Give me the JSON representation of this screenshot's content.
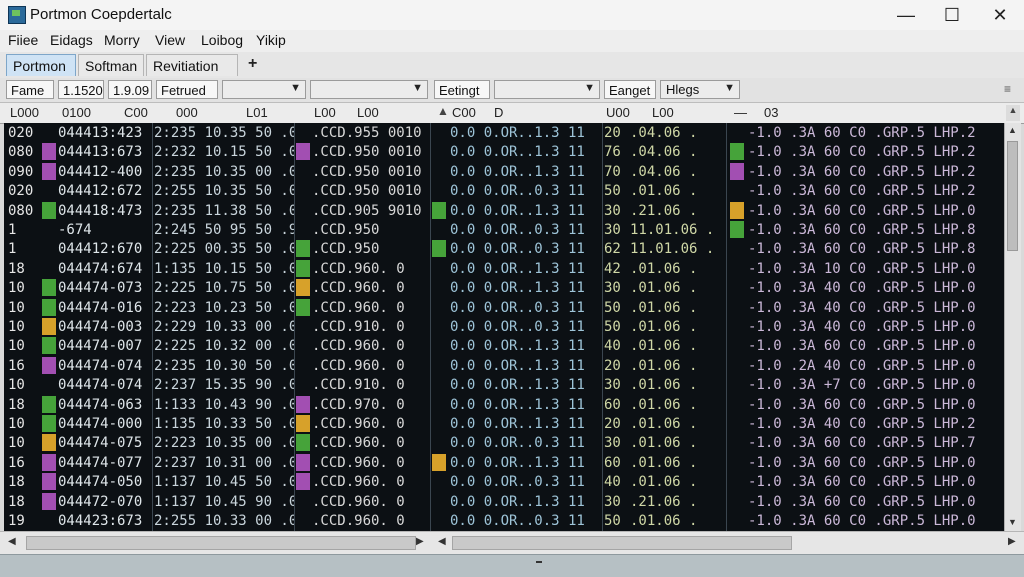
{
  "window": {
    "title": "Portmon Coepdertalc",
    "minimize": "—",
    "maximize": "☐",
    "close": "✕"
  },
  "menu": [
    "Fiiee",
    "Eidags",
    "Morry",
    "View",
    "Loibog",
    "Yikip"
  ],
  "tabs": [
    {
      "label": "Portmon",
      "active": true
    },
    {
      "label": "Softman",
      "active": false
    },
    {
      "label": "Revitiation",
      "active": false
    }
  ],
  "tab_add": "+",
  "toolbar": {
    "frame_label": "Fame",
    "field1": "1.1520",
    "field2": "1.9.09",
    "filter_label": "Fetrued",
    "settings_label": "Eetingt",
    "range_label": "Eanget",
    "flags_label": "Hlegs",
    "right_icon": "≡"
  },
  "columns": [
    "L000",
    "0100",
    "C00",
    "000",
    "L01",
    "L00",
    "L00",
    "C00",
    "D",
    "U00",
    "L00",
    "—",
    "03"
  ],
  "rows": [
    [
      "020",
      "A",
      "044413:423",
      "2:235 10.35 50 .0",
      "",
      ".CCD.955 0010",
      "",
      "0.0 0.OR..1.3 11",
      "20",
      ".04.06 .",
      "",
      "-1.0 .3A 60 C0 .GRP.5 LHP.2"
    ],
    [
      "080",
      "V",
      "044413:673",
      "2:232 10.15 50 .0",
      "V",
      ".CCD.950 0010",
      "",
      "0.0 0.OR..1.3 11",
      "76",
      ".04.06 .",
      "G",
      "-1.0 .3A 60 C0 .GRP.5 LHP.2"
    ],
    [
      "090",
      "V",
      "044412-400",
      "2:235 10.35 00 .0",
      "",
      ".CCD.950 0010",
      "",
      "0.0 0.OR..1.3 11",
      "70",
      ".04.06 .",
      "V",
      "-1.0 .3A 60 C0 .GRP.5 LHP.2"
    ],
    [
      "020",
      "",
      "044412:672",
      "2:255 10.35 50 .0",
      "",
      ".CCD.950 0010",
      "",
      "0.0 0.OR..0.3 11",
      "50",
      ".01.06 .",
      "",
      "-1.0 .3A 60 C0 .GRP.5 LHP.2"
    ],
    [
      "080",
      "G",
      "044418:473",
      "2:235 11.38 50 .0",
      "",
      ".CCD.905 9010",
      "G",
      "0.0 0.OR..1.3 11",
      "30",
      ".21.06 .",
      "O",
      "-1.0 .3A 60 C0 .GRP.5 LHP.0"
    ],
    [
      "1",
      "",
      "-674",
      "2:245 50 95 50 .9",
      "",
      ".CCD.950",
      "",
      "0.0 0.OR..0.3 11",
      "30",
      "11.01.06 .",
      "G",
      "-1.0 .3A 60 C0 .GRP.5 LHP.8"
    ],
    [
      "1",
      "",
      "044412:670",
      "2:225 00.35 50 .0",
      "G",
      ".CCD.950",
      "G",
      "0.0 0.OR..0.3 11",
      "62",
      "11.01.06 .",
      "",
      "-1.0 .3A 60 C0 .GRP.5 LHP.8"
    ],
    [
      "18",
      "",
      "044474:674",
      "1:135 10.15 50 .0",
      "G",
      ".CCD.960. 0",
      "",
      "0.0 0.OR..1.3 11",
      "42",
      ".01.06 .",
      "",
      "-1.0 .3A 10 C0 .GRP.5 LHP.0"
    ],
    [
      "10",
      "G",
      "044474-073",
      "2:225 10.75 50 .0",
      "O",
      ".CCD.960. 0",
      "",
      "0.0 0.OR..1.3 11",
      "30",
      ".01.06 .",
      "",
      "-1.0 .3A 40 C0 .GRP.5 LHP.0"
    ],
    [
      "10",
      "G",
      "044474-016",
      "2:223 10.23 50 .0",
      "G",
      ".CCD.960. 0",
      "",
      "0.0 0.OR..0.3 11",
      "50",
      ".01.06 .",
      "",
      "-1.0 .3A 40 C0 .GRP.5 LHP.0"
    ],
    [
      "10",
      "O",
      "044474-003",
      "2:229 10.33 00 .0",
      "",
      ".CCD.910. 0",
      "",
      "0.0 0.OR..0.3 11",
      "50",
      ".01.06 .",
      "",
      "-1.0 .3A 40 C0 .GRP.5 LHP.0"
    ],
    [
      "10",
      "G",
      "044474-007",
      "2:225 10.32 00 .0",
      "",
      ".CCD.960. 0",
      "",
      "0.0 0.OR..1.3 11",
      "40",
      ".01.06 .",
      "",
      "-1.0 .3A 60 C0 .GRP.5 LHP.0"
    ],
    [
      "16",
      "V",
      "044474-074",
      "2:235 10.30 50 .0",
      "",
      ".CCD.960. 0",
      "",
      "0.0 0.OR..1.3 11",
      "20",
      ".01.06 .",
      "",
      "-1.0 .2A 40 C0 .GRP.5 LHP.0"
    ],
    [
      "10",
      "",
      "044474-074",
      "2:237 15.35 90 .0",
      "",
      ".CCD.910. 0",
      "",
      "0.0 0.OR..1.3 11",
      "30",
      ".01.06 .",
      "",
      "-1.0 .3A +7 C0 .GRP.5 LHP.0"
    ],
    [
      "18",
      "G",
      "044474-063",
      "1:133 10.43 90 .0",
      "V",
      ".CCD.970. 0",
      "",
      "0.0 0.OR..1.3 11",
      "60",
      ".01.06 .",
      "",
      "-1.0 .3A 60 C0 .GRP.5 LHP.0"
    ],
    [
      "10",
      "G",
      "044474-000",
      "1:135 10.33 50 .0",
      "O",
      ".CCD.960. 0",
      "",
      "0.0 0.OR..1.3 11",
      "20",
      ".01.06 .",
      "",
      "-1.0 .3A 40 C0 .GRP.5 LHP.2"
    ],
    [
      "10",
      "O",
      "044474-075",
      "2:223 10.35 00 .0",
      "G",
      ".CCD.960. 0",
      "",
      "0.0 0.OR..0.3 11",
      "30",
      ".01.06 .",
      "",
      "-1.0 .3A 60 C0 .GRP.5 LHP.7"
    ],
    [
      "16",
      "V",
      "044474-077",
      "2:237 10.31 00 .0",
      "V",
      ".CCD.960. 0",
      "O",
      "0.0 0.OR..1.3 11",
      "60",
      ".01.06 .",
      "",
      "-1.0 .3A 60 C0 .GRP.5 LHP.0"
    ],
    [
      "18",
      "V",
      "044474-050",
      "1:137 10.45 50 .0",
      "V",
      ".CCD.960. 0",
      "",
      "0.0 0.OR..0.3 11",
      "40",
      ".01.06 .",
      "",
      "-1.0 .3A 60 C0 .GRP.5 LHP.0"
    ],
    [
      "18",
      "V",
      "044472-070",
      "1:137 10.45 90 .0",
      "",
      ".CCD.960. 0",
      "",
      "0.0 0.OR..1.3 11",
      "30",
      ".21.06 .",
      "",
      "-1.0 .3A 60 C0 .GRP.5 LHP.0"
    ],
    [
      "19",
      "",
      "044423:673",
      "2:255 10.33 00 .0",
      "",
      ".CCD.960. 0",
      "",
      "0.0 0.OR..0.3 11",
      "50",
      ".01.06 .",
      "",
      "-1.0 .3A 60 C0 .GRP.5 LHP.0"
    ]
  ],
  "swatch_colors": {
    "G": "#46a33a",
    "V": "#a24fb2",
    "O": "#d7a12a"
  },
  "text_colors": {
    "id": "#e6e6e6",
    "addr": "#dfe6ea",
    "time": "#c9d5dc",
    "val": "#d8d8d8",
    "mid": "#9ec4d8",
    "num": "#cfd7a6",
    "tail": "#cbb8d8"
  },
  "scroll": {
    "up": "▲",
    "down": "▼",
    "left": "◀",
    "right": "▶"
  }
}
